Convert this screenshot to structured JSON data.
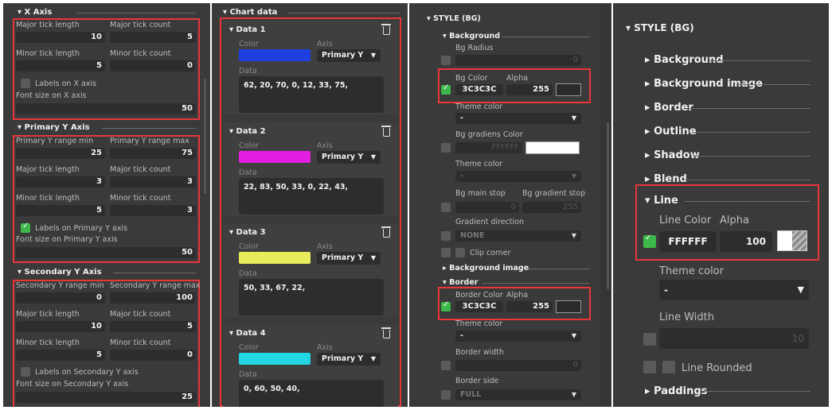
{
  "panel1": {
    "x_axis": {
      "title": "X Axis",
      "major_tick_length_label": "Major tick length",
      "major_tick_length": "10",
      "major_tick_count_label": "Major tick count",
      "major_tick_count": "5",
      "minor_tick_length_label": "Minor tick length",
      "minor_tick_length": "5",
      "minor_tick_count_label": "Minor tick count",
      "minor_tick_count": "0",
      "labels_label": "Labels on X axis",
      "font_size_label": "Font size on X axis",
      "font_size": "50"
    },
    "primary_y": {
      "title": "Primary Y Axis",
      "range_min_label": "Primary Y range min",
      "range_min": "25",
      "range_max_label": "Primary Y range max",
      "range_max": "75",
      "major_tick_length_label": "Major tick length",
      "major_tick_length": "3",
      "major_tick_count_label": "Major tick count",
      "major_tick_count": "3",
      "minor_tick_length_label": "Minor tick length",
      "minor_tick_length": "5",
      "minor_tick_count_label": "Minor tick count",
      "minor_tick_count": "3",
      "labels_label": "Labels on Primary Y axis",
      "font_size_label": "Font size on Primary Y axis",
      "font_size": "50"
    },
    "secondary_y": {
      "title": "Secondary Y Axis",
      "range_min_label": "Secondary Y range min",
      "range_min": "0",
      "range_max_label": "Secondary Y range max",
      "range_max": "100",
      "major_tick_length_label": "Major tick length",
      "major_tick_length": "10",
      "major_tick_count_label": "Major tick count",
      "major_tick_count": "5",
      "minor_tick_length_label": "Minor tick length",
      "minor_tick_length": "5",
      "minor_tick_count_label": "Minor tick count",
      "minor_tick_count": "0",
      "labels_label": "Labels on Secondary Y axis",
      "font_size_label": "Font size on Secondary Y axis",
      "font_size": "25"
    }
  },
  "panel2": {
    "title": "Chart data",
    "color_label": "Color",
    "axis_label": "Axis",
    "data_label": "Data",
    "items": [
      {
        "name": "Data 1",
        "color": "#1f3fe0",
        "axis": "Primary Y",
        "data": "62, 20, 70, 0, 12, 33, 75,"
      },
      {
        "name": "Data 2",
        "color": "#e21ee0",
        "axis": "Primary Y",
        "data": "22, 83, 50, 33, 0, 22, 43,"
      },
      {
        "name": "Data 3",
        "color": "#e8ec5a",
        "axis": "Primary Y",
        "data": "50, 33, 67, 22,"
      },
      {
        "name": "Data 4",
        "color": "#22d7e2",
        "axis": "Primary Y",
        "data": "0, 60, 50, 40,"
      }
    ]
  },
  "panel3": {
    "title": "STYLE (BG)",
    "background": "Background",
    "bg_radius_label": "Bg Radius",
    "bg_radius": "0",
    "bg_color_label": "Bg Color",
    "alpha_label": "Alpha",
    "bg_color": "3C3C3C",
    "bg_alpha": "255",
    "theme_color_label": "Theme color",
    "theme_color": "-",
    "bg_gradient_label": "Bg gradiens Color",
    "bg_gradient": "FFFFFF",
    "theme_color2": "-",
    "bg_main_stop_label": "Bg main stop",
    "bg_gradient_stop_label": "Bg gradient stop",
    "bg_main_stop": "0",
    "bg_gradient_stop": "255",
    "gradient_direction_label": "Gradient direction",
    "gradient_direction": "NONE",
    "clip_corner_label": "Clip corner",
    "background_image": "Background image",
    "border": "Border",
    "border_color_label": "Border Color",
    "border_alpha_label": "Alpha",
    "border_color": "3C3C3C",
    "border_alpha": "255",
    "border_theme_label": "Theme color",
    "border_theme": "-",
    "border_width_label": "Border width",
    "border_width": "0",
    "border_side_label": "Border side",
    "border_side": "FULL",
    "swatch_dark": "#2a2a2a",
    "swatch_white": "#ffffff"
  },
  "panel4": {
    "title": "STYLE (BG)",
    "sections": [
      "Background",
      "Background image",
      "Border",
      "Outline",
      "Shadow",
      "Blend"
    ],
    "line": "Line",
    "line_color_label": "Line Color",
    "alpha_label": "Alpha",
    "line_color": "FFFFFF",
    "line_alpha": "100",
    "theme_color_label": "Theme color",
    "theme_color": "-",
    "line_width_label": "Line Width",
    "line_width": "10",
    "line_rounded_label": "Line Rounded",
    "paddings": "Paddings"
  }
}
